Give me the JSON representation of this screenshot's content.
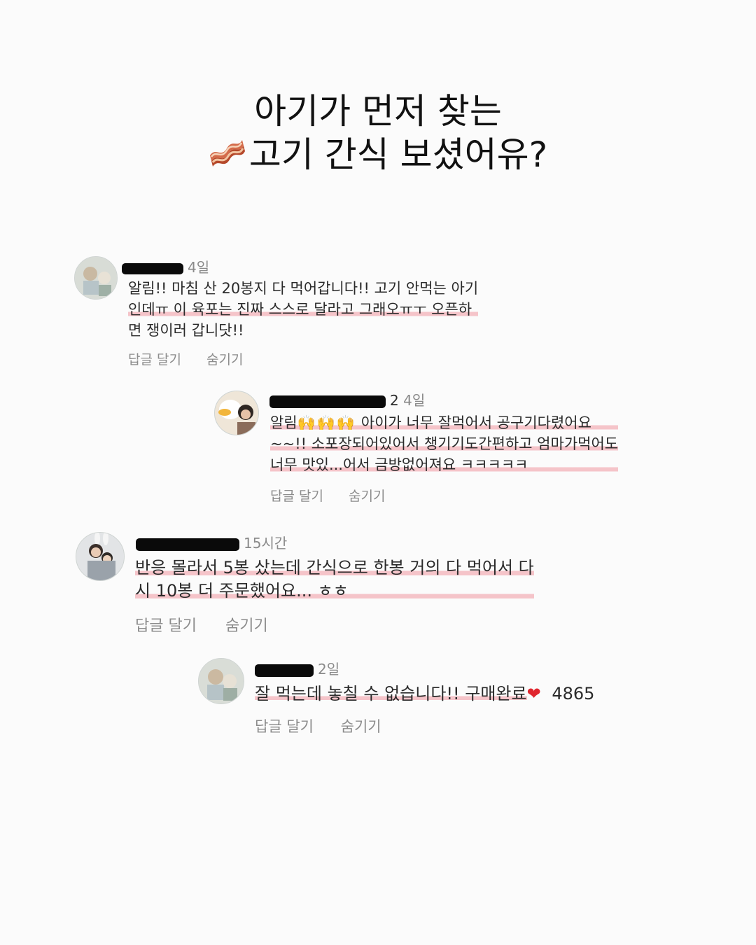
{
  "headline": {
    "line1": "아기가 먼저 찾는",
    "line2": "고기 간식 보셨어유?",
    "emoji_icon": "bacon"
  },
  "comments": [
    {
      "time": "4일",
      "lines": [
        "알림!! 마침 산 20봉지 다 먹어갑니다!! 고기 안먹는 아기",
        "인데ㅠ 이 육포는 진짜 스스로 달라고 그래오ㅠㅜ 오픈하",
        "면 쟁이러 갑니닷!!"
      ],
      "reply": "답글 달기",
      "hide": "숨기기"
    },
    {
      "username_visible": "2",
      "time": "4일",
      "lines": [
        "알림",
        "아이가 너무 잘먹어서 공구기다렸어요",
        "~~!! 소포장되어있어서 챙기기도간편하고 엄마가먹어도",
        "너무 맛있...어서 금방없어져요 ㅋㅋㅋㅋㅋ"
      ],
      "emoji": "🙌🙌🙌",
      "reply": "답글 달기",
      "hide": "숨기기"
    },
    {
      "time": "15시간",
      "lines": [
        "반응 몰라서 5봉 샀는데 간식으로 한봉 거의 다 먹어서 다",
        "시 10봉 더 주문했어요... ㅎㅎ"
      ],
      "reply": "답글 달기",
      "hide": "숨기기"
    },
    {
      "time": "2일",
      "lines": [
        "잘 먹는데 놓칠 수 없습니다!! 구매완료"
      ],
      "heart": "❤",
      "code": "4865",
      "reply": "답글 달기",
      "hide": "숨기기"
    }
  ]
}
